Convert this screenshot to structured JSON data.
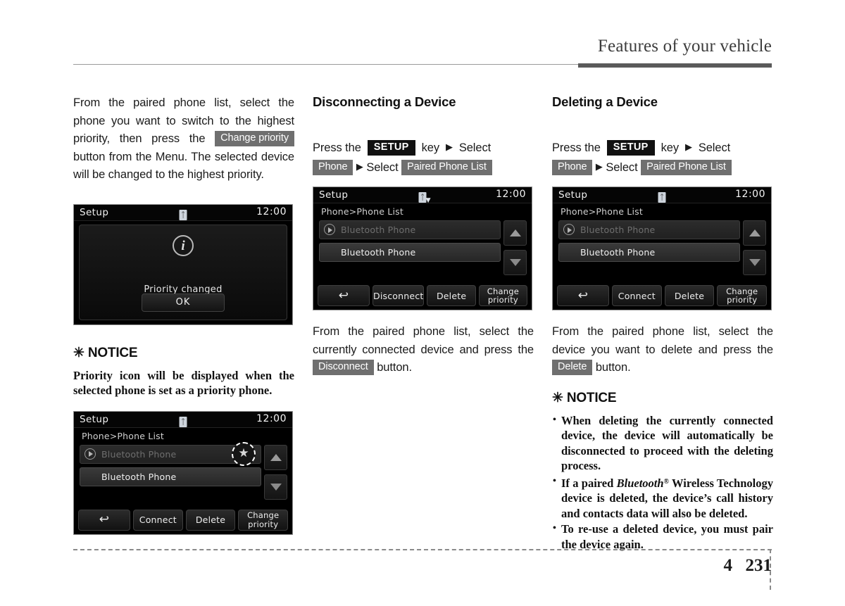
{
  "header": {
    "title": "Features of your vehicle"
  },
  "footer": {
    "chapter": "4",
    "page": "231"
  },
  "col1": {
    "paragraph_before": "From the paired phone list, select the phone you want to switch to the highest priority, then press the",
    "badge_change_priority": "Change priority",
    "paragraph_after": "button from the Menu. The selected device will be changed to the highest priority.",
    "dialog_screen": {
      "title": "Setup",
      "bt_icon": "bluetooth-icon",
      "clock": "12:00",
      "info_icon": "i",
      "message": "Priority changed",
      "ok_label": "OK"
    },
    "notice": {
      "heading": "NOTICE",
      "asterisk": "✳",
      "body": "Priority icon will be displayed when the selected phone is set as a priority phone."
    },
    "list_screen": {
      "title": "Setup",
      "clock": "12:00",
      "breadcrumb": "Phone>Phone List",
      "rows": [
        {
          "label": "Bluetooth Phone",
          "state": "dim"
        },
        {
          "label": "Bluetooth Phone",
          "state": "sel"
        }
      ],
      "star_badge": "★",
      "buttons": {
        "back": "↩",
        "b1": "Connect",
        "b2": "Delete",
        "b3_line1": "Change",
        "b3_line2": "priority"
      }
    }
  },
  "col2": {
    "heading": "Disconnecting a Device",
    "steps": {
      "press_the": "Press  the",
      "setup_key": "SETUP",
      "key_word": "key",
      "arrow": "▶",
      "select_1": "Select",
      "phone": "Phone",
      "select_2": "Select",
      "paired_phone_list": "Paired Phone List"
    },
    "screen": {
      "title": "Setup",
      "clock": "12:00",
      "breadcrumb": "Phone>Phone List",
      "rows": [
        {
          "label": "Bluetooth Phone",
          "state": "dim"
        },
        {
          "label": "Bluetooth Phone",
          "state": "sel"
        }
      ],
      "buttons": {
        "back": "↩",
        "b1": "Disconnect",
        "b2": "Delete",
        "b3_line1": "Change",
        "b3_line2": "priority"
      }
    },
    "paragraph_before": "From the paired phone list, select the currently connected device and press the",
    "badge_disconnect": "Disconnect",
    "paragraph_after": "button."
  },
  "col3": {
    "heading": "Deleting a Device",
    "steps": {
      "press_the": "Press  the",
      "setup_key": "SETUP",
      "key_word": "key",
      "arrow": "▶",
      "select_1": "Select",
      "phone": "Phone",
      "select_2": "Select",
      "paired_phone_list": "Paired Phone List"
    },
    "screen": {
      "title": "Setup",
      "clock": "12:00",
      "breadcrumb": "Phone>Phone List",
      "rows": [
        {
          "label": "Bluetooth Phone",
          "state": "dim"
        },
        {
          "label": "Bluetooth Phone",
          "state": "sel"
        }
      ],
      "buttons": {
        "back": "↩",
        "b1": "Connect",
        "b2": "Delete",
        "b3_line1": "Change",
        "b3_line2": "priority"
      }
    },
    "paragraph_before": "From the paired phone list, select the device you want to delete and press the",
    "badge_delete": "Delete",
    "paragraph_after": "button.",
    "notice": {
      "heading": "NOTICE",
      "asterisk": "✳",
      "items": [
        {
          "text": "When deleting the currently connected device, the device will automatically be disconnected to proceed with the deleting process."
        },
        {
          "pre": "If a paired ",
          "em": "Bluetooth",
          "reg": "®",
          "post": " Wireless Technology device is deleted, the device’s call history and contacts data will also be deleted."
        },
        {
          "text": "To re-use a deleted device, you must pair the device again."
        }
      ]
    }
  }
}
